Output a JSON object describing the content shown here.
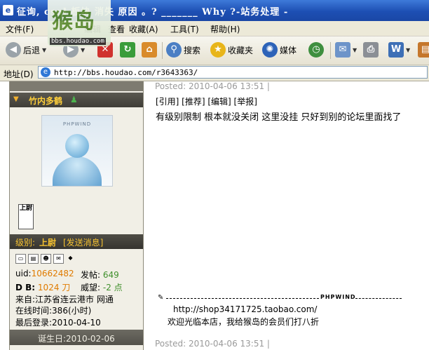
{
  "window": {
    "title": "征询, csol 板块 消失 原因 。? _______ Why ?-站务处理 -"
  },
  "logo": {
    "mark": "猴岛",
    "url": "bbs.houdao.com"
  },
  "menu": {
    "file": "文件(F)",
    "edit": "编辑",
    "view": "查看",
    "favorites": "收藏(A)",
    "tools": "工具(T)",
    "help": "帮助(H)"
  },
  "toolbar": {
    "back": "后退",
    "search": "搜索",
    "favorites": "收藏夹",
    "media": "媒体"
  },
  "address": {
    "label": "地址(D)",
    "url": "http://bbs.houdao.com/r3643363/"
  },
  "user": {
    "name": "竹内多鹤",
    "avatar_brand": "PHPWIND",
    "rank_badge": "上尉",
    "level_label": "级别:",
    "level_value": "上尉",
    "send_message": "[发送消息]",
    "uid_label": "uid:",
    "uid_value": "10662482",
    "posts_label": "发帖:",
    "posts_value": "649",
    "db_label": "D B:",
    "db_value": "1024 刀",
    "prestige_label": "威望:",
    "prestige_value": "-2 点",
    "from": "来自:江苏省连云港市 网通",
    "online_time": "在线时间:386(小时)",
    "last_login": "最后登录:2010-04-10",
    "birthday": "诞生日:2010-02-06"
  },
  "post": {
    "posted_top": "Posted: 2010-04-06 13:51 |",
    "actions": "[引用] [推荐] [编辑] [举报]",
    "text": "有级别限制 根本就没关闭 这里没挂 只好到别的论坛里面找了",
    "signature_brand": "PHPWIND",
    "signature_url": "http://shop34171725.taobao.com/",
    "signature_text": "欢迎光临本店，我给猴岛的会员们打八折",
    "posted_bottom": "Posted: 2010-04-06 13:51 |"
  }
}
